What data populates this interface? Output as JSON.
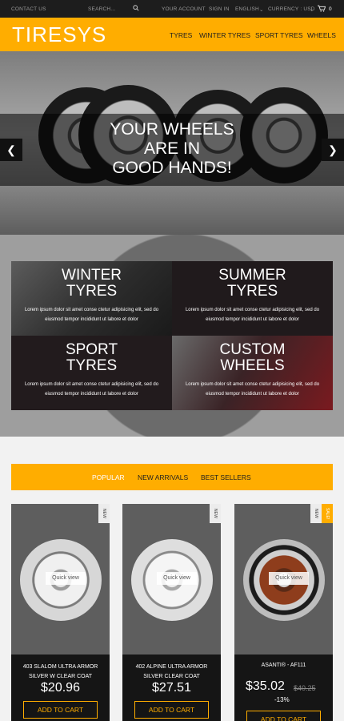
{
  "topbar": {
    "contact": "CONTACT US",
    "search_placeholder": "SEARCH...",
    "account": "YOUR ACCOUNT",
    "signin": "SIGN IN",
    "language": "ENGLISH",
    "currency": "CURRENCY : USD",
    "cart_count": "0"
  },
  "header": {
    "logo": "TIRESYS",
    "nav": [
      "TYRES",
      "WINTER TYRES",
      "SPORT TYRES",
      "WHEELS"
    ]
  },
  "hero": {
    "title_lines": [
      "YOUR WHEELS",
      "ARE IN",
      "GOOD HANDS!"
    ]
  },
  "categories": [
    {
      "title_lines": [
        "WINTER",
        "TYRES"
      ],
      "desc": "Lorem ipsum dolor sit amet conse ctetur adipisicing elit, sed do eiusmod tempor incididunt ut labore et dolor"
    },
    {
      "title_lines": [
        "SUMMER",
        "TYRES"
      ],
      "desc": "Lorem ipsum dolor sit amet conse ctetur adipisicing elit, sed do eiusmod tempor incididunt ut labore et dolor"
    },
    {
      "title_lines": [
        "SPORT",
        "TYRES"
      ],
      "desc": "Lorem ipsum dolor sit amet conse ctetur adipisicing elit, sed do eiusmod tempor incididunt ut labore et dolor"
    },
    {
      "title_lines": [
        "CUSTOM",
        "WHEELS"
      ],
      "desc": "Lorem ipsum dolor sit amet conse ctetur adipisicing elit, sed do eiusmod tempor incididunt ut labore et dolor"
    }
  ],
  "tabs": [
    "POPULAR",
    "NEW ARRIVALS",
    "BEST SELLERS"
  ],
  "products": [
    {
      "badges": [
        "NEW"
      ],
      "quick_view": "Quick view",
      "name": "403 SLALOM ULTRA ARMOR SILVER W CLEAR COAT",
      "price": "$20.96",
      "add": "ADD TO CART"
    },
    {
      "badges": [
        "NEW"
      ],
      "quick_view": "Quick view",
      "name": "402 ALPINE ULTRA ARMOR SILVER CLEAR COAT",
      "price": "$27.51",
      "add": "ADD TO CART"
    },
    {
      "badges": [
        "NEW",
        "SALE!"
      ],
      "quick_view": "Quick view",
      "name": "ASANTI® - AF111",
      "price": "$35.02",
      "old_price": "$40.25",
      "discount": "-13%",
      "add": "ADD TO CART"
    }
  ],
  "colors": {
    "accent": "#ffad00",
    "topbar": "#1d1d1d",
    "product_info": "#151515"
  }
}
